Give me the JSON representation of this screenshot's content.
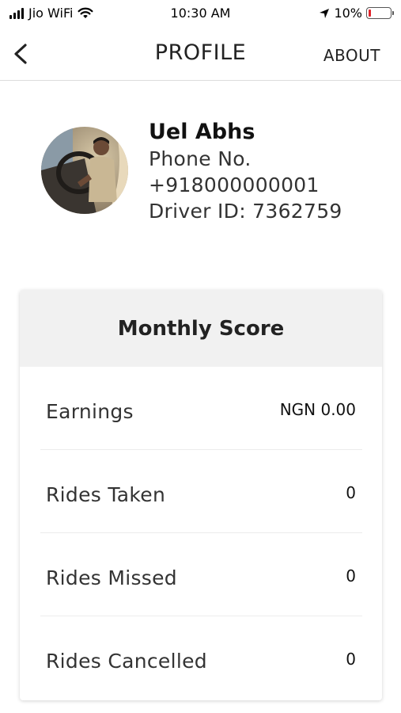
{
  "status_bar": {
    "carrier": "Jio WiFi",
    "time": "10:30 AM",
    "battery": "10%",
    "battery_level": 0.1,
    "battery_color": "#e0242b"
  },
  "nav": {
    "back_icon": "chevron-left-icon",
    "title": "PROFILE",
    "about_label": "ABOUT"
  },
  "profile": {
    "name": "Uel Abhs",
    "phone_label": "Phone No.",
    "phone": "+918000000001",
    "driver_id": "Driver ID: 7362759"
  },
  "monthly_score": {
    "title": "Monthly Score",
    "rows": [
      {
        "label": "Earnings",
        "value": "NGN 0.00"
      },
      {
        "label": "Rides Taken",
        "value": "0"
      },
      {
        "label": "Rides Missed",
        "value": "0"
      },
      {
        "label": "Rides Cancelled",
        "value": "0"
      }
    ]
  }
}
